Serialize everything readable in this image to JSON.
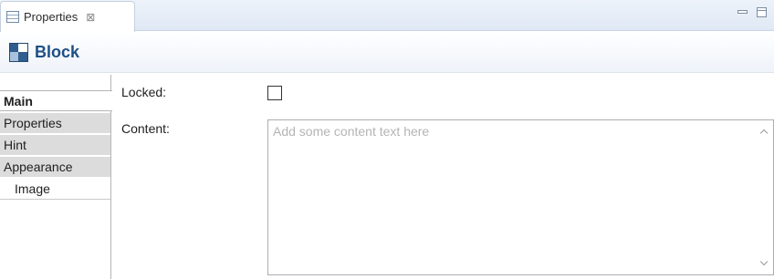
{
  "view": {
    "tab_label": "Properties",
    "tab_icon": "properties-view-icon",
    "close_glyph": "⊠",
    "minimize_icon": "minimize-icon",
    "maximize_icon": "maximize-icon"
  },
  "header": {
    "icon": "block-icon",
    "title": "Block",
    "title_color": "#1d4f86"
  },
  "sidebar": {
    "items": [
      {
        "label": "Main",
        "selected": true
      },
      {
        "label": "Properties",
        "selected": false
      },
      {
        "label": "Hint",
        "selected": false
      },
      {
        "label": "Appearance",
        "selected": false
      },
      {
        "label": "Image",
        "selected": false,
        "child": true
      }
    ]
  },
  "form": {
    "locked_label": "Locked:",
    "locked_checked": false,
    "content_label": "Content:",
    "content_value": "",
    "content_placeholder": "Add some content text here"
  }
}
